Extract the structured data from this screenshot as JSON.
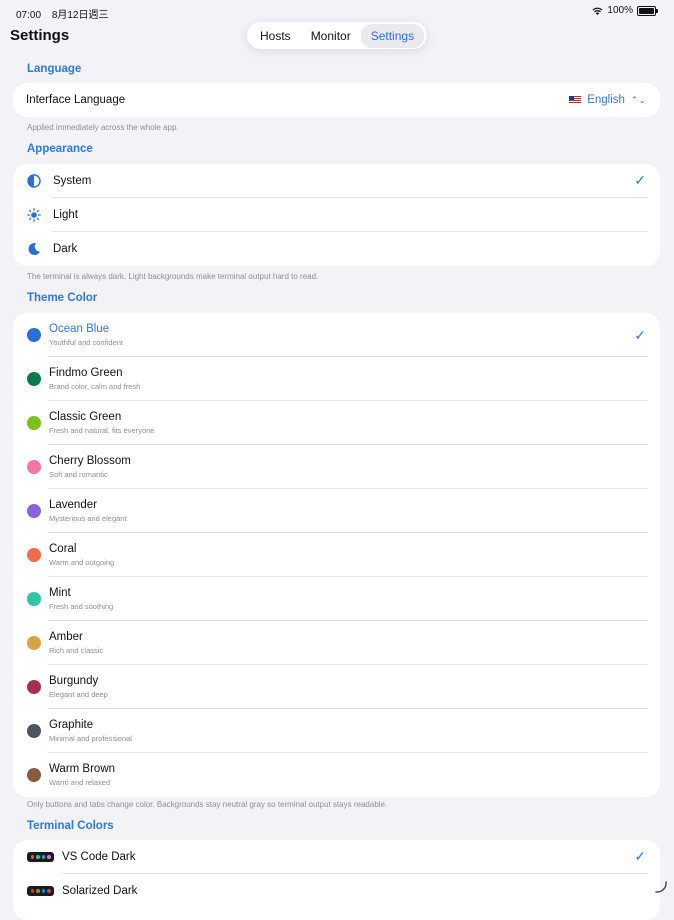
{
  "status": {
    "time": "07:00",
    "date": "8月12日週三",
    "battery": "100%",
    "battery_level": 1.0
  },
  "app": {
    "title": "Settings"
  },
  "tabs": [
    {
      "label": "Hosts",
      "active": false
    },
    {
      "label": "Monitor",
      "active": false
    },
    {
      "label": "Settings",
      "active": true
    }
  ],
  "language": {
    "section_title": "Language",
    "row_label": "Interface Language",
    "value": "English",
    "note": "Applied immediately across the whole app."
  },
  "appearance": {
    "section_title": "Appearance",
    "options": [
      {
        "label": "System",
        "icon": "half-circle-icon",
        "selected": true
      },
      {
        "label": "Light",
        "icon": "sun-icon",
        "selected": false
      },
      {
        "label": "Dark",
        "icon": "moon-icon",
        "selected": false
      }
    ],
    "note": "The terminal is always dark. Light backgrounds make terminal output hard to read."
  },
  "theme": {
    "section_title": "Theme Color",
    "colors": [
      {
        "name": "Ocean Blue",
        "desc": "Youthful and confident",
        "color": "#2b6fd6",
        "selected": true
      },
      {
        "name": "Findmo Green",
        "desc": "Brand color, calm and fresh",
        "color": "#0c7a4e",
        "selected": false
      },
      {
        "name": "Classic Green",
        "desc": "Fresh and natural, fits everyone",
        "color": "#7ac21b",
        "selected": false
      },
      {
        "name": "Cherry Blossom",
        "desc": "Soft and romantic",
        "color": "#f277a6",
        "selected": false
      },
      {
        "name": "Lavender",
        "desc": "Mysterious and elegant",
        "color": "#8a63d9",
        "selected": false
      },
      {
        "name": "Coral",
        "desc": "Warm and outgoing",
        "color": "#f46a4b",
        "selected": false
      },
      {
        "name": "Mint",
        "desc": "Fresh and soothing",
        "color": "#2ec4a5",
        "selected": false
      },
      {
        "name": "Amber",
        "desc": "Rich and classic",
        "color": "#d6a444",
        "selected": false
      },
      {
        "name": "Burgundy",
        "desc": "Elegant and deep",
        "color": "#a8304f",
        "selected": false
      },
      {
        "name": "Graphite",
        "desc": "Minimal and professional",
        "color": "#4a5560",
        "selected": false
      },
      {
        "name": "Warm Brown",
        "desc": "Warm and relaxed",
        "color": "#8b5a3c",
        "selected": false
      }
    ],
    "note": "Only buttons and tabs change color. Backgrounds stay neutral gray so terminal output stays readable."
  },
  "terminal": {
    "section_title": "Terminal Colors",
    "schemes": [
      {
        "name": "VS Code Dark",
        "selected": true,
        "swatches": [
          "#f14c4c",
          "#23d18b",
          "#3b8eea",
          "#d670d6"
        ]
      },
      {
        "name": "Solarized Dark",
        "selected": false,
        "swatches": [
          "#dc322f",
          "#859900",
          "#268bd2",
          "#d33682"
        ]
      }
    ]
  },
  "accent": "#2f78db"
}
